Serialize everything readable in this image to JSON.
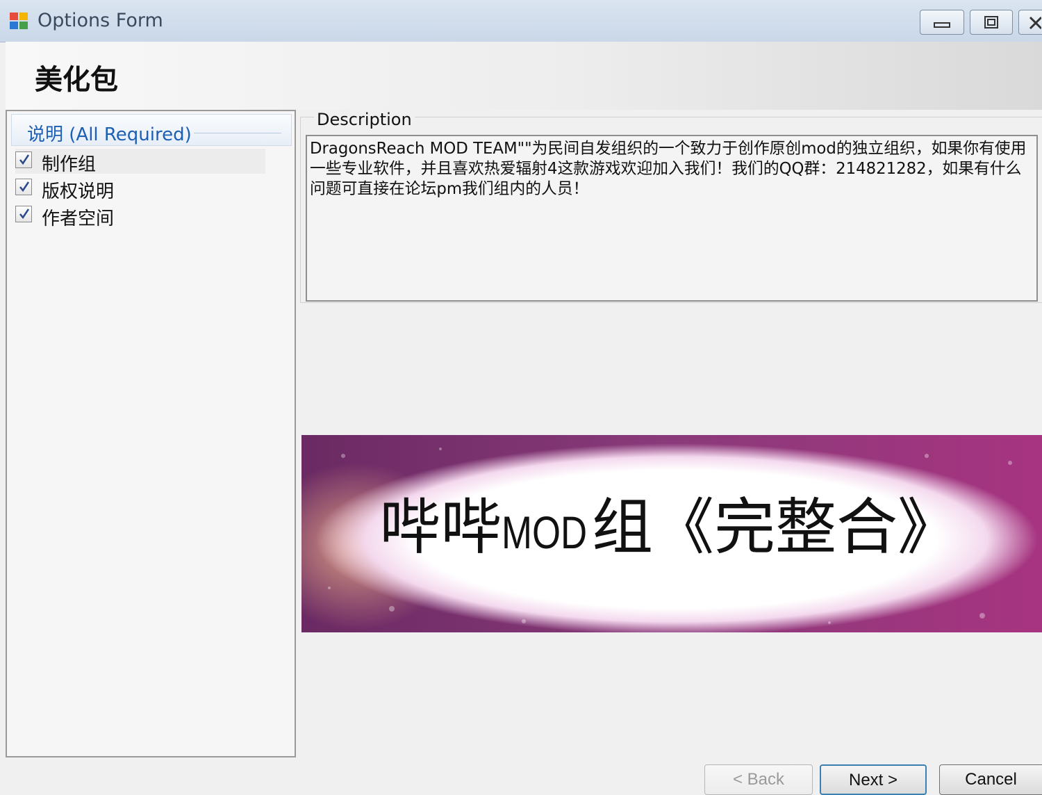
{
  "window": {
    "title": "Options Form",
    "accent_color": "#1c5fb4"
  },
  "header": {
    "title": "美化包"
  },
  "options": {
    "group_label": "说明 (All Required)",
    "items": [
      {
        "label": "制作组",
        "checked": true,
        "selected": true
      },
      {
        "label": "版权说明",
        "checked": true,
        "selected": false
      },
      {
        "label": "作者空间",
        "checked": true,
        "selected": false
      }
    ]
  },
  "description": {
    "label": "Description",
    "text": "DragonsReach MOD TEAM\"\"为民间自发组织的一个致力于创作原创mod的独立组织，如果你有使用一些专业软件，并且喜欢热爱辐射4这款游戏欢迎加入我们！我们的QQ群：214821282，如果有什么问题可直接在论坛pm我们组内的人员！"
  },
  "banner": {
    "text_part1": "哔哔",
    "text_part2": "MOD",
    "text_part3": "组《完整合》"
  },
  "buttons": {
    "back": "< Back",
    "next": "Next >",
    "cancel": "Cancel"
  },
  "icons": {
    "app": "windows-app-icon",
    "minimize": "minimize-icon",
    "maximize": "maximize-icon",
    "close": "close-icon",
    "check": "checkmark-icon"
  }
}
